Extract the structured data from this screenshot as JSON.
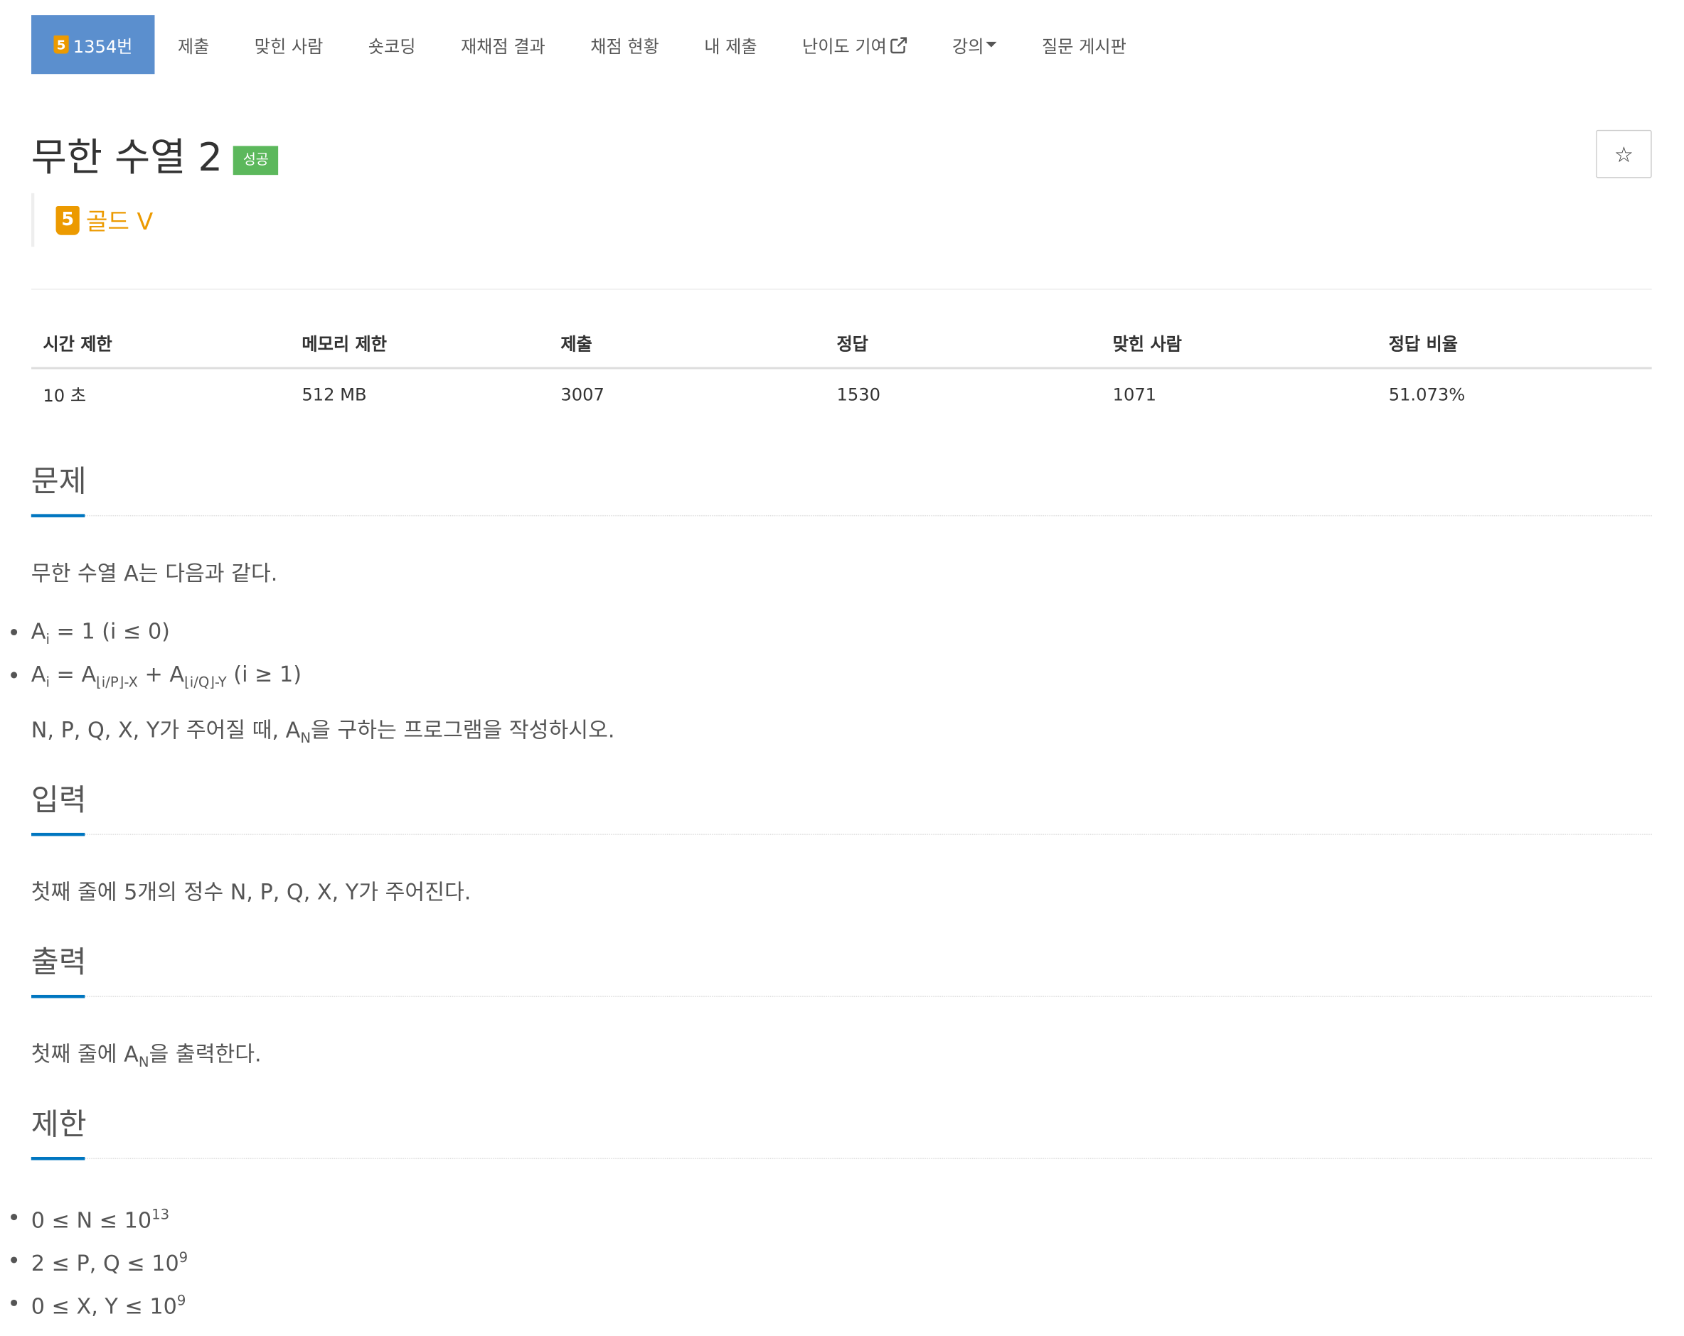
{
  "nav": {
    "items": [
      {
        "tier": "5",
        "label": "1354번",
        "active": true
      },
      {
        "label": "제출"
      },
      {
        "label": "맞힌 사람"
      },
      {
        "label": "숏코딩"
      },
      {
        "label": "재채점 결과"
      },
      {
        "label": "채점 현황"
      },
      {
        "label": "내 제출"
      },
      {
        "label": "난이도 기여"
      },
      {
        "label": "강의"
      },
      {
        "label": "질문 게시판"
      }
    ]
  },
  "problem": {
    "title": "무한 수열 2",
    "status_badge": "성공",
    "star_glyph": "☆",
    "tier_number": "5",
    "tier_label": "골드 V",
    "tier_color": "#ec9a00"
  },
  "info_table": {
    "headers": [
      "시간 제한",
      "메모리 제한",
      "제출",
      "정답",
      "맞힌 사람",
      "정답 비율"
    ],
    "values": [
      "10 초",
      "512 MB",
      "3007",
      "1530",
      "1071",
      "51.073%"
    ]
  },
  "sections": {
    "problem": {
      "heading": "문제",
      "intro": "무한 수열 A는 다음과 같다.",
      "rule1": {
        "a": "A",
        "i": "i",
        "rest": " = 1 (i ≤ 0)"
      },
      "rule2": {
        "a": "A",
        "i": "i",
        "eq": " = A",
        "sub1": "⌊i/P⌋-X",
        "plus": " + A",
        "sub2": "⌊i/Q⌋-Y",
        "cond": " (i ≥ 1)"
      },
      "task_pre": "N, P, Q, X, Y가 주어질 때, A",
      "task_sub": "N",
      "task_post": "을 구하는 프로그램을 작성하시오."
    },
    "input": {
      "heading": "입력",
      "text": "첫째 줄에 5개의 정수 N, P, Q, X, Y가 주어진다."
    },
    "output": {
      "heading": "출력",
      "text_pre": "첫째 줄에 A",
      "text_sub": "N",
      "text_post": "을 출력한다."
    },
    "limits": {
      "heading": "제한",
      "items": [
        {
          "text": "0 ≤ N ≤ 10",
          "exp": "13"
        },
        {
          "text": "2 ≤ P, Q ≤ 10",
          "exp": "9"
        },
        {
          "text": "0 ≤ X, Y ≤ 10",
          "exp": "9"
        }
      ]
    }
  },
  "colors": {
    "nav_active": "#5b8fce",
    "success_badge": "#5cb85c",
    "section_underline": "#0076c0"
  }
}
